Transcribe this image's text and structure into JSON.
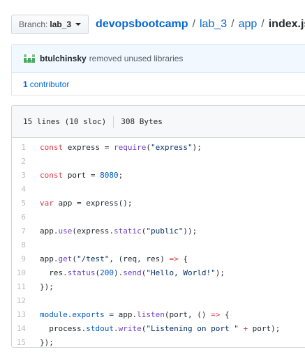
{
  "branch": {
    "label": "Branch:",
    "value": "lab_3"
  },
  "breadcrumb": {
    "repo": "devopsbootcamp",
    "seg1": "lab_3",
    "seg2": "app",
    "file": "index.js",
    "sep": "/"
  },
  "commit": {
    "author": "btulchinsky",
    "message": "removed unused libraries",
    "contributors_count": "1",
    "contributors_label": "contributor"
  },
  "file_info": {
    "lines": "15 lines (10 sloc)",
    "size": "308 Bytes"
  },
  "colors": {
    "link": "#0366d6",
    "keyword": "#d73a49",
    "function": "#6f42c1",
    "number": "#005cc5",
    "string": "#032f62",
    "commit_bg": "#f1f8ff"
  },
  "code_lines": [
    {
      "n": "1",
      "tokens": [
        [
          "k",
          "const"
        ],
        [
          "t",
          " express = "
        ],
        [
          "f",
          "require"
        ],
        [
          "t",
          "("
        ],
        [
          "s",
          "\"express\""
        ],
        [
          "t",
          ");"
        ]
      ]
    },
    {
      "n": "2",
      "tokens": []
    },
    {
      "n": "3",
      "tokens": [
        [
          "k",
          "const"
        ],
        [
          "t",
          " port = "
        ],
        [
          "n",
          "8080"
        ],
        [
          "t",
          ";"
        ]
      ]
    },
    {
      "n": "4",
      "tokens": []
    },
    {
      "n": "5",
      "tokens": [
        [
          "k",
          "var"
        ],
        [
          "t",
          " app = express();"
        ]
      ]
    },
    {
      "n": "6",
      "tokens": []
    },
    {
      "n": "7",
      "tokens": [
        [
          "t",
          "app."
        ],
        [
          "f",
          "use"
        ],
        [
          "t",
          "(express."
        ],
        [
          "f",
          "static"
        ],
        [
          "t",
          "("
        ],
        [
          "s",
          "\"public\""
        ],
        [
          "t",
          "));"
        ]
      ]
    },
    {
      "n": "8",
      "tokens": []
    },
    {
      "n": "9",
      "tokens": [
        [
          "t",
          "app."
        ],
        [
          "f",
          "get"
        ],
        [
          "t",
          "("
        ],
        [
          "s",
          "\"/test\""
        ],
        [
          "t",
          ", (req, res) "
        ],
        [
          "k",
          "=>"
        ],
        [
          "t",
          " {"
        ]
      ]
    },
    {
      "n": "10",
      "tokens": [
        [
          "t",
          "  res."
        ],
        [
          "f",
          "status"
        ],
        [
          "t",
          "("
        ],
        [
          "n",
          "200"
        ],
        [
          "t",
          ")."
        ],
        [
          "f",
          "send"
        ],
        [
          "t",
          "("
        ],
        [
          "s",
          "\"Hello, World!\""
        ],
        [
          "t",
          ");"
        ]
      ]
    },
    {
      "n": "11",
      "tokens": [
        [
          "t",
          "});"
        ]
      ]
    },
    {
      "n": "12",
      "tokens": []
    },
    {
      "n": "13",
      "tokens": [
        [
          "n",
          "module"
        ],
        [
          "t",
          "."
        ],
        [
          "n",
          "exports"
        ],
        [
          "t",
          " = app."
        ],
        [
          "f",
          "listen"
        ],
        [
          "t",
          "(port, () "
        ],
        [
          "k",
          "=>"
        ],
        [
          "t",
          " {"
        ]
      ]
    },
    {
      "n": "14",
      "tokens": [
        [
          "t",
          "  process."
        ],
        [
          "n",
          "stdout"
        ],
        [
          "t",
          "."
        ],
        [
          "f",
          "write"
        ],
        [
          "t",
          "("
        ],
        [
          "s",
          "\"Listening on port \""
        ],
        [
          "t",
          " "
        ],
        [
          "k",
          "+"
        ],
        [
          "t",
          " port);"
        ]
      ]
    },
    {
      "n": "15",
      "tokens": [
        [
          "t",
          "});"
        ]
      ]
    }
  ]
}
